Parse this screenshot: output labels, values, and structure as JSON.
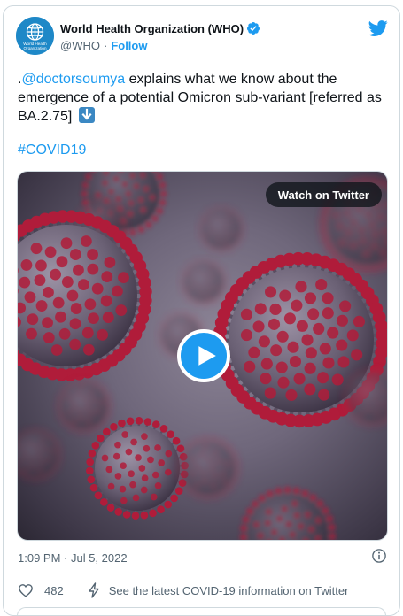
{
  "account": {
    "display_name": "World Health Organization (WHO)",
    "handle": "@WHO",
    "separator": "·",
    "follow_label": "Follow",
    "avatar_text_line1": "World Health",
    "avatar_text_line2": "Organization"
  },
  "tweet": {
    "prefix": ".",
    "mention": "@doctorsoumya",
    "text": " explains what we know about the emergence of a potential Omicron sub-variant [referred as BA.2.75] ",
    "emoji": "down-arrow-emoji",
    "hashtag": "#COVID19"
  },
  "media": {
    "watch_label": "Watch on Twitter",
    "play_icon": "play-icon"
  },
  "meta": {
    "timestamp": "1:09 PM · Jul 5, 2022",
    "info_icon": "info-icon"
  },
  "actions": {
    "like_count": "482",
    "latest_label": "See the latest COVID-19 information on Twitter"
  },
  "colors": {
    "accent": "#1d9bf0",
    "text": "#0f1419",
    "muted": "#536471",
    "border": "#cfd9de",
    "virus_red": "#b01c3a"
  }
}
